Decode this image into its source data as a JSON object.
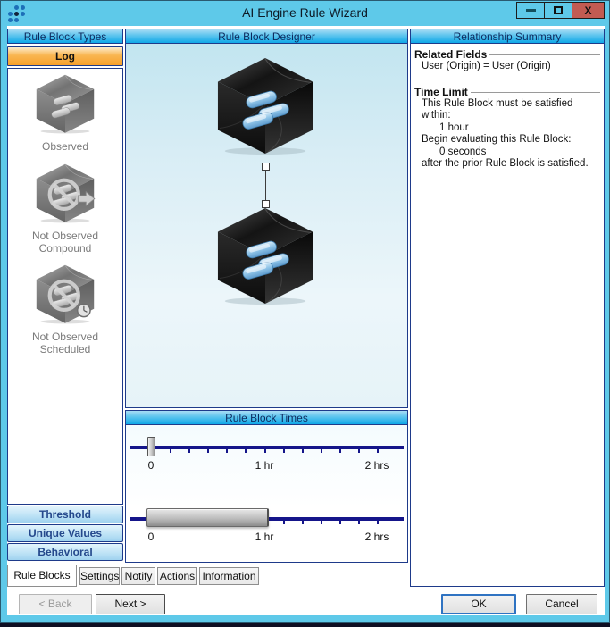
{
  "window": {
    "title": "AI Engine Rule Wizard",
    "close_glyph": "X"
  },
  "left_panel": {
    "header": "Rule Block Types",
    "selected_type": "Log",
    "types": [
      {
        "label_line1": "Observed",
        "label_line2": ""
      },
      {
        "label_line1": "Not Observed",
        "label_line2": "Compound"
      },
      {
        "label_line1": "Not Observed",
        "label_line2": "Scheduled"
      }
    ],
    "categories": [
      "Threshold",
      "Unique Values",
      "Behavioral"
    ]
  },
  "designer": {
    "header": "Rule Block Designer"
  },
  "times": {
    "header": "Rule Block Times",
    "timeline1_labels": [
      "0",
      "1 hr",
      "2 hrs"
    ],
    "timeline2_labels": [
      "0",
      "1 hr",
      "2 hrs"
    ]
  },
  "summary": {
    "header": "Relationship Summary",
    "related_fields": {
      "title": "Related Fields",
      "value": "User (Origin) = User (Origin)"
    },
    "time_limit": {
      "title": "Time Limit",
      "line1": "This Rule Block must be satisfied within:",
      "value1": "1 hour",
      "line2": "Begin evaluating this Rule Block:",
      "value2": "0 seconds",
      "line3": "after the prior Rule Block is satisfied."
    }
  },
  "tabs": [
    "Rule Blocks",
    "Settings",
    "Notify",
    "Actions",
    "Information"
  ],
  "footer": {
    "back": "< Back",
    "next": "Next >",
    "ok": "OK",
    "cancel": "Cancel"
  },
  "colors": {
    "titlebar_blue": "#5EC9E9",
    "header_blue": "#0FA8E8",
    "log_orange": "#F6A02C",
    "close_red": "#C25B52",
    "timeline_navy": "#15158A",
    "panel_border_navy": "#1E3A8A"
  }
}
